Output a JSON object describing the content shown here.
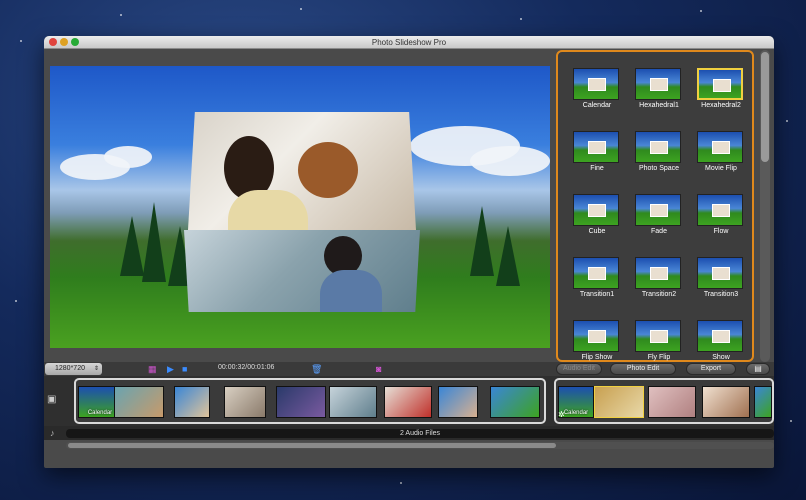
{
  "window": {
    "title": "Photo Slideshow Pro"
  },
  "effects": [
    {
      "label": "Calendar"
    },
    {
      "label": "Hexahedral1"
    },
    {
      "label": "Hexahedral2"
    },
    {
      "label": "Fine"
    },
    {
      "label": "Photo Space"
    },
    {
      "label": "Movie Flip"
    },
    {
      "label": "Cube"
    },
    {
      "label": "Fade"
    },
    {
      "label": "Flow"
    },
    {
      "label": "Transition1"
    },
    {
      "label": "Transition2"
    },
    {
      "label": "Transition3"
    },
    {
      "label": "Flip Show"
    },
    {
      "label": "Fly Flip"
    },
    {
      "label": "Show"
    }
  ],
  "selected_effect": "Hexahedral2",
  "controls": {
    "resolution": "1280*720",
    "time": "00:00:32/00:01:06",
    "audio_edit_label": "Audio Edit",
    "photo_edit_label": "Photo Edit",
    "export_label": "Export"
  },
  "timeline": {
    "clip1_label": "Calendar",
    "clip2_label": "Calendar"
  },
  "audio": {
    "label": "2 Audio Files"
  },
  "colors": {
    "accent": "#e0891c",
    "selection": "#f0d040"
  }
}
